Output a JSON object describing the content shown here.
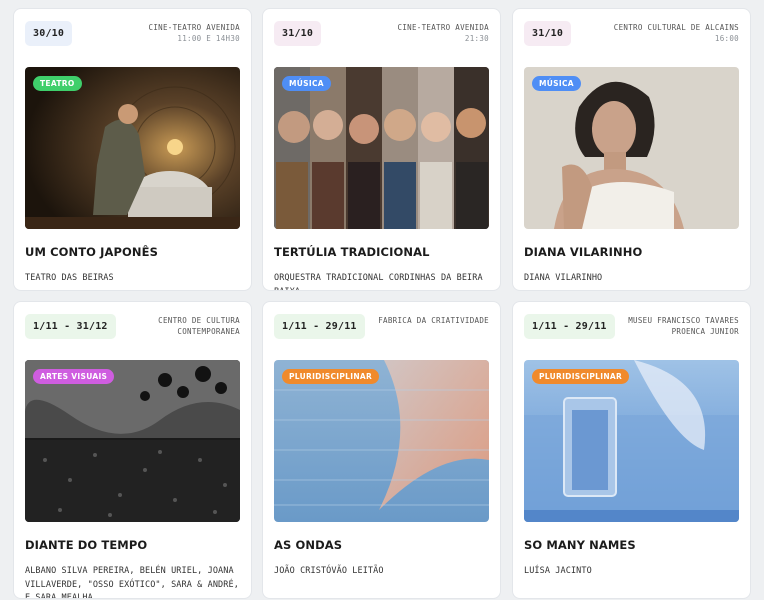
{
  "events": [
    {
      "date": "30/10",
      "venue": "CINE-TEATRO AVENIDA",
      "time": "11:00 E 14H30",
      "category": "TEATRO",
      "category_color": "#3fcf6b",
      "title": "UM CONTO JAPONÊS",
      "artist": "TEATRO DAS BEIRAS"
    },
    {
      "date": "31/10",
      "venue": "CINE-TEATRO AVENIDA",
      "time": "21:30",
      "category": "MÚSICA",
      "category_color": "#4f8ef5",
      "title": "TERTÚLIA TRADICIONAL",
      "artist": "ORQUESTRA TRADICIONAL CORDINHAS DA BEIRA BAIXA"
    },
    {
      "date": "31/10",
      "venue": "CENTRO CULTURAL DE ALCAINS",
      "time": "16:00",
      "category": "MÚSICA",
      "category_color": "#4f8ef5",
      "title": "DIANA VILARINHO",
      "artist": "DIANA VILARINHO"
    },
    {
      "date": "1/11 - 31/12",
      "venue": "CENTRO DE CULTURA CONTEMPORANEA",
      "time": "",
      "category": "ARTES VISUAIS",
      "category_color": "#cf5de0",
      "title": "DIANTE DO TEMPO",
      "artist": "ALBANO SILVA PEREIRA, BELÉN URIEL, JOANA VILLAVERDE, \"OSSO EXÓTICO\", SARA & ANDRÉ, E SARA MEALHA."
    },
    {
      "date": "1/11 - 29/11",
      "venue": "FABRICA DA CRIATIVIDADE",
      "time": "",
      "category": "PLURIDISCIPLINAR",
      "category_color": "#f08a2c",
      "title": "AS ONDAS",
      "artist": "JOÃO CRISTÓVÃO LEITÃO"
    },
    {
      "date": "1/11 - 29/11",
      "venue": "MUSEU FRANCISCO TAVARES PROENCA JUNIOR",
      "time": "",
      "category": "PLURIDISCIPLINAR",
      "category_color": "#f08a2c",
      "title": "SO MANY NAMES",
      "artist": "LUÍSA JACINTO"
    }
  ]
}
